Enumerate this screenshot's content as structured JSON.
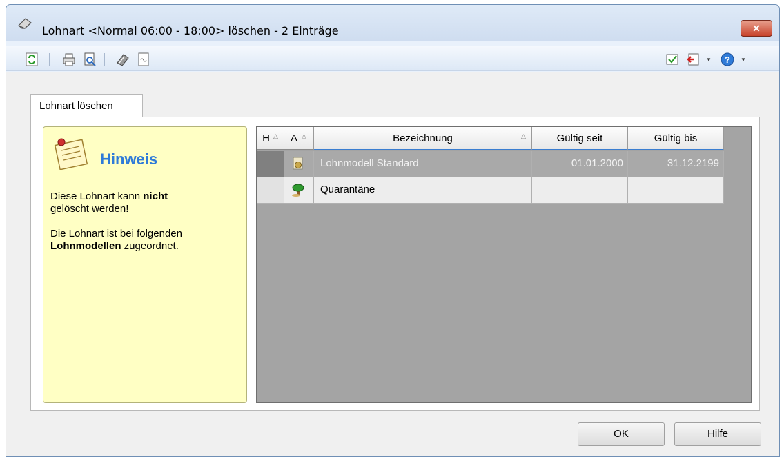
{
  "window": {
    "title": "Lohnart <Normal 06:00 - 18:00> löschen - 2 Einträge",
    "close_label": "✕"
  },
  "toolbar": {
    "left_icons": [
      "refresh-icon",
      "print-icon",
      "print-preview-icon",
      "export-icon",
      "document-icon"
    ],
    "right_icons": [
      "checklist-icon",
      "exit-icon",
      "help-icon"
    ]
  },
  "tab": {
    "label": "Lohnart löschen"
  },
  "hint": {
    "title": "Hinweis",
    "line1_pre": "Diese Lohnart kann ",
    "line1_bold": "nicht",
    "line1_post": "gelöscht werden!",
    "line2_pre": "Die Lohnart ist bei folgenden",
    "line2_bold": "Lohnmodellen",
    "line2_post": " zugeordnet."
  },
  "grid": {
    "columns": [
      "H",
      "A",
      "Bezeichnung",
      "Gültig seit",
      "Gültig bis"
    ],
    "sort_glyph": "△",
    "rows": [
      {
        "icon": "wage-model-icon",
        "bezeichnung": "Lohnmodell Standard",
        "gueltig_seit": "01.01.2000",
        "gueltig_bis": "31.12.2199"
      },
      {
        "icon": "palm-tree-icon",
        "bezeichnung": "Quarantäne",
        "gueltig_seit": "",
        "gueltig_bis": ""
      }
    ]
  },
  "buttons": {
    "ok": "OK",
    "help": "Hilfe"
  },
  "colors": {
    "hint_background": "#ffffc4",
    "hint_title": "#2f7bd8",
    "grid_background": "#a4a4a4"
  }
}
